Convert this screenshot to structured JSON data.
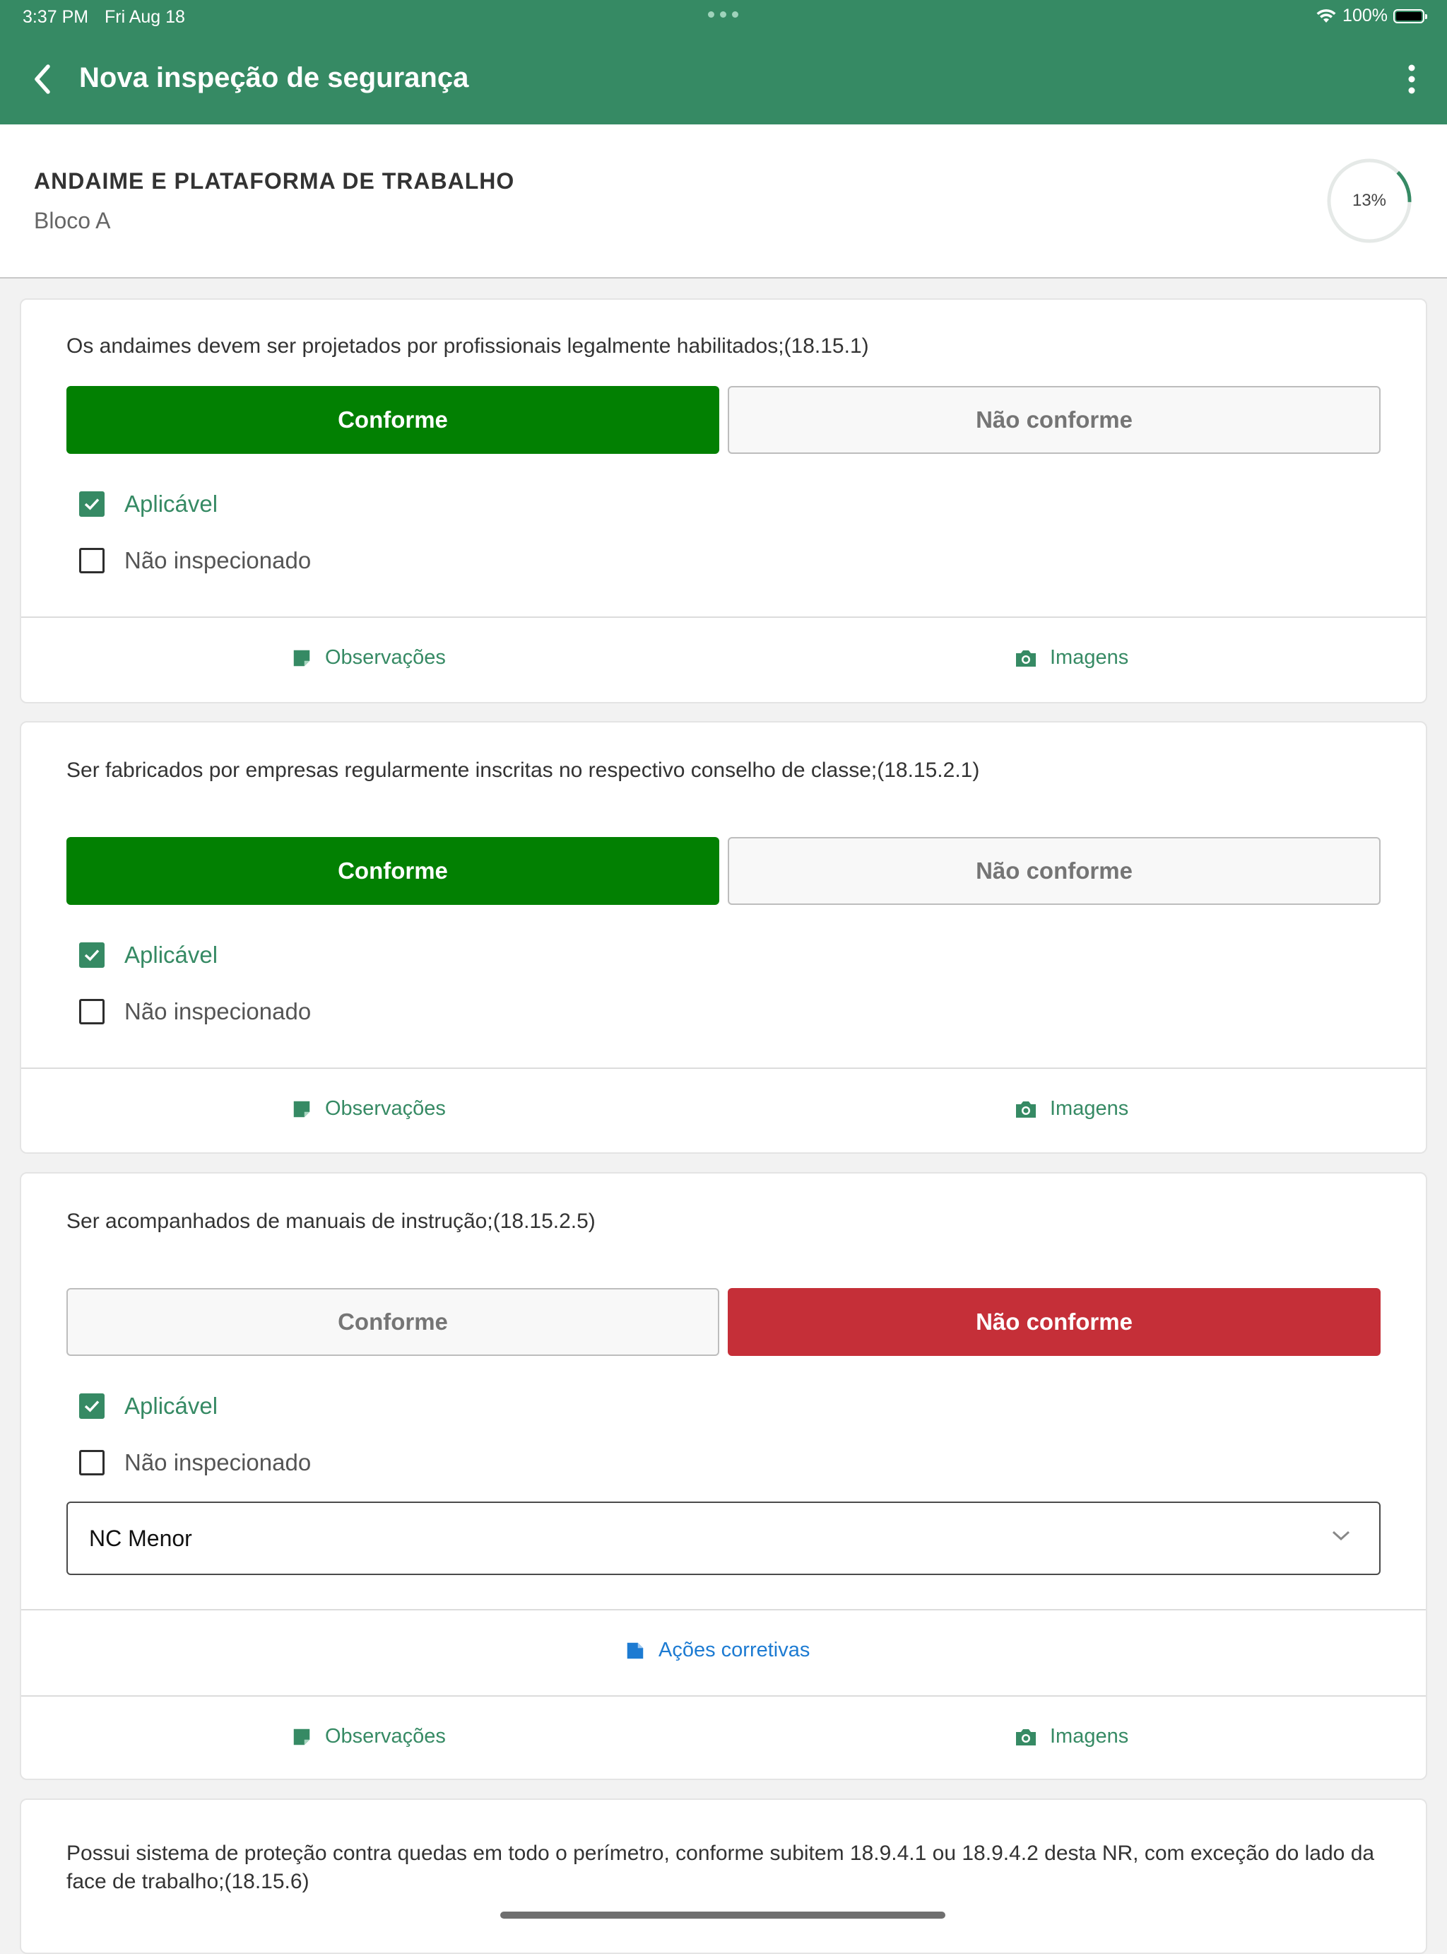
{
  "status_bar": {
    "time": "3:37 PM",
    "date": "Fri Aug 18",
    "battery": "100%"
  },
  "header": {
    "title": "Nova inspeção de segurança"
  },
  "section": {
    "title": "ANDAIME E PLATAFORMA DE TRABALHO",
    "subtitle": "Bloco A",
    "progress_label": "13%",
    "progress": 0.13
  },
  "colors": {
    "primary": "#368a64",
    "conforme": "#028002",
    "nao_conforme": "#c52f38",
    "link_blue": "#1d7bd2"
  },
  "items": [
    {
      "question": "Os andaimes devem ser projetados por profissionais legalmente habilitados;(18.15.1)",
      "conforme_label": "Conforme",
      "nao_conforme_label": "Não conforme",
      "selected": "conforme",
      "aplicavel_label": "Aplicável",
      "aplicavel_checked": true,
      "nao_inspecionado_label": "Não inspecionado",
      "nao_inspecionado_checked": false,
      "observacoes_label": "Observações",
      "imagens_label": "Imagens"
    },
    {
      "question": "Ser fabricados por empresas regularmente inscritas no respectivo conselho de classe;(18.15.2.1)",
      "conforme_label": "Conforme",
      "nao_conforme_label": "Não conforme",
      "selected": "conforme",
      "aplicavel_label": "Aplicável",
      "aplicavel_checked": true,
      "nao_inspecionado_label": "Não inspecionado",
      "nao_inspecionado_checked": false,
      "observacoes_label": "Observações",
      "imagens_label": "Imagens"
    },
    {
      "question": "Ser acompanhados de manuais de instrução;(18.15.2.5)",
      "conforme_label": "Conforme",
      "nao_conforme_label": "Não conforme",
      "selected": "nao_conforme",
      "aplicavel_label": "Aplicável",
      "aplicavel_checked": true,
      "nao_inspecionado_label": "Não inspecionado",
      "nao_inspecionado_checked": false,
      "severity_value": "NC Menor",
      "acoes_corretivas_label": "Ações corretivas",
      "observacoes_label": "Observações",
      "imagens_label": "Imagens"
    },
    {
      "question": "Possui sistema de proteção contra quedas em todo o perímetro, conforme subitem 18.9.4.1 ou 18.9.4.2 desta NR, com exceção do lado da face de trabalho;(18.15.6)"
    }
  ]
}
